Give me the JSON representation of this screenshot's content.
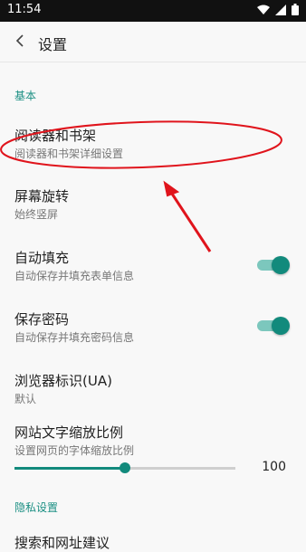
{
  "status_bar": {
    "time": "11:54"
  },
  "app_bar": {
    "title": "设置"
  },
  "sections": {
    "basic": "基本",
    "privacy": "隐私设置"
  },
  "items": {
    "reader": {
      "title": "阅读器和书架",
      "subtitle": "阅读器和书架详细设置"
    },
    "rotation": {
      "title": "屏幕旋转",
      "subtitle": "始终竖屏"
    },
    "autofill": {
      "title": "自动填充",
      "subtitle": "自动保存并填充表单信息",
      "toggle_on": true
    },
    "save_password": {
      "title": "保存密码",
      "subtitle": "自动保存并填充密码信息",
      "toggle_on": true
    },
    "ua": {
      "title": "浏览器标识(UA)",
      "subtitle": "默认"
    },
    "text_zoom": {
      "title": "网站文字缩放比例",
      "subtitle": "设置网页的字体缩放比例",
      "value": "100",
      "slider_fraction": 0.5
    },
    "search_suggest": {
      "title": "搜索和网址建议"
    }
  },
  "colors": {
    "accent": "#128a7c",
    "annotation": "#e0141c"
  },
  "icons": {
    "back": "chevron-left-icon",
    "wifi": "wifi-icon",
    "signal": "signal-icon",
    "battery": "battery-icon"
  }
}
